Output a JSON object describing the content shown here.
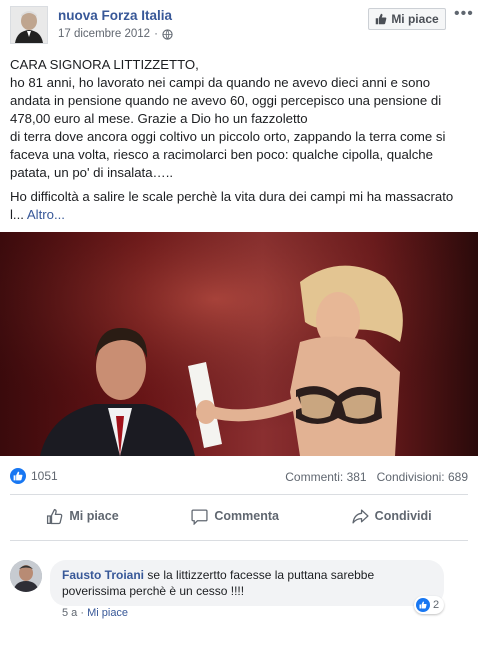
{
  "header": {
    "page_name": "nuova Forza Italia",
    "date": "17 dicembre 2012",
    "separator": "·",
    "like_page_label": "Mi piace",
    "more_label": "•••"
  },
  "post": {
    "lines": [
      "CARA SIGNORA LITTIZZETTO,",
      "ho 81 anni, ho lavorato nei campi da quando ne avevo dieci anni e sono",
      "andata in pensione quando ne avevo 60, oggi percepisco una pensione di",
      "478,00 euro al mese. Grazie a Dio ho un fazzoletto",
      "di terra dove ancora oggi coltivo un piccolo orto, zappando la terra come si",
      "faceva una volta, riesco a racimolarci ben poco: qualche cipolla, qualche",
      "patata, un po' di insalata….."
    ],
    "para2_line1": "Ho difficoltà a salire le scale perchè la vita dura dei campi mi ha massacrato",
    "para2_line2": "l...",
    "more_link": "Altro..."
  },
  "stats": {
    "likes": "1051",
    "comments": "Commenti: 381",
    "shares": "Condivisioni: 689"
  },
  "actions": {
    "like": "Mi piace",
    "comment": "Commenta",
    "share": "Condividi"
  },
  "comment": {
    "author": "Fausto Troiani",
    "text": "se la littizzertto facesse la puttana sarebbe poverissima perchè è un cesso !!!!",
    "reactions": "2",
    "age": "5 a",
    "separator": "·",
    "like_label": "Mi piace"
  },
  "colors": {
    "link": "#385898",
    "like_blue": "#1877f2",
    "muted": "#606770"
  },
  "icons": {
    "globe": "globe-icon",
    "thumbs_up": "thumbs-up-icon",
    "comment": "comment-icon",
    "share": "share-icon"
  }
}
